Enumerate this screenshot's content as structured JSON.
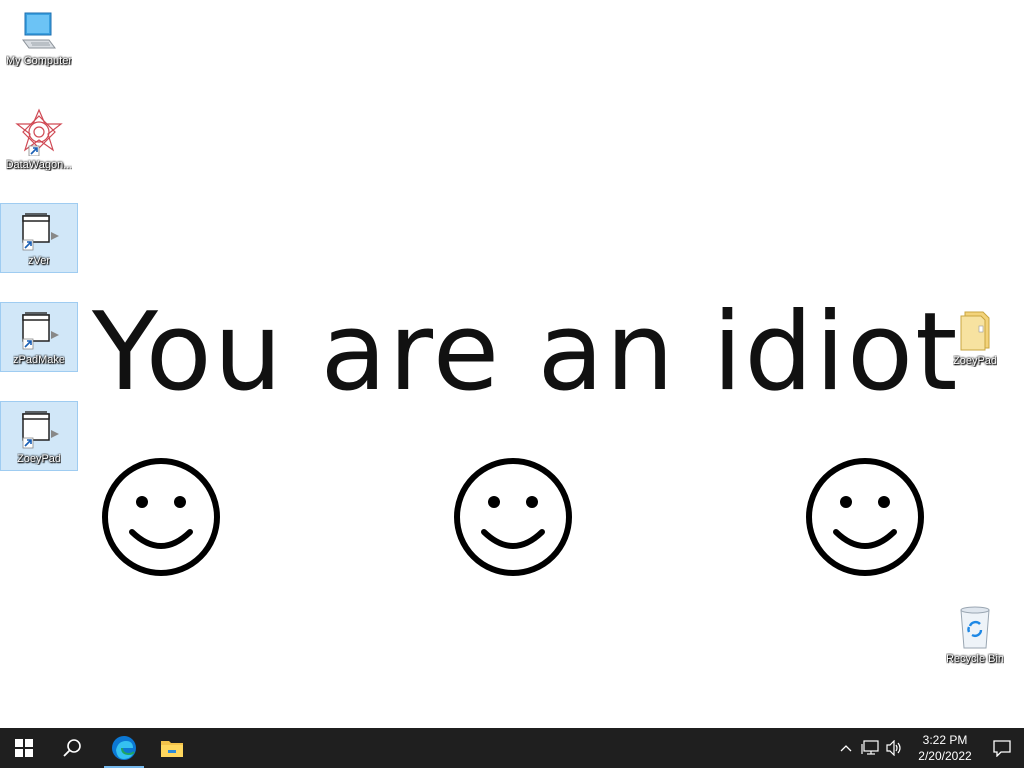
{
  "desktop": {
    "icons": [
      {
        "label": "My Computer",
        "icon": "computer-icon"
      },
      {
        "label": "DataWagon...",
        "icon": "datawagon-icon"
      },
      {
        "label": "zVer",
        "icon": "zver-shortcut-icon"
      },
      {
        "label": "zPadMake",
        "icon": "zpadmake-shortcut-icon"
      },
      {
        "label": "ZoeyPad",
        "icon": "zoeypad-shortcut-icon"
      },
      {
        "label": "ZoeyPad",
        "icon": "folder-icon"
      },
      {
        "label": "Recycle Bin",
        "icon": "recycle-bin-icon"
      }
    ],
    "message": "You are an idiot"
  },
  "taskbar": {
    "buttons": [
      "start-icon",
      "search-icon",
      "edge-icon",
      "file-explorer-icon"
    ],
    "clock_time": "3:22 PM",
    "clock_date": "2/20/2022"
  },
  "colors": {
    "taskbar_bg": "#1f1f1f",
    "selection": "#99c9ef",
    "message_text": "#111111"
  }
}
